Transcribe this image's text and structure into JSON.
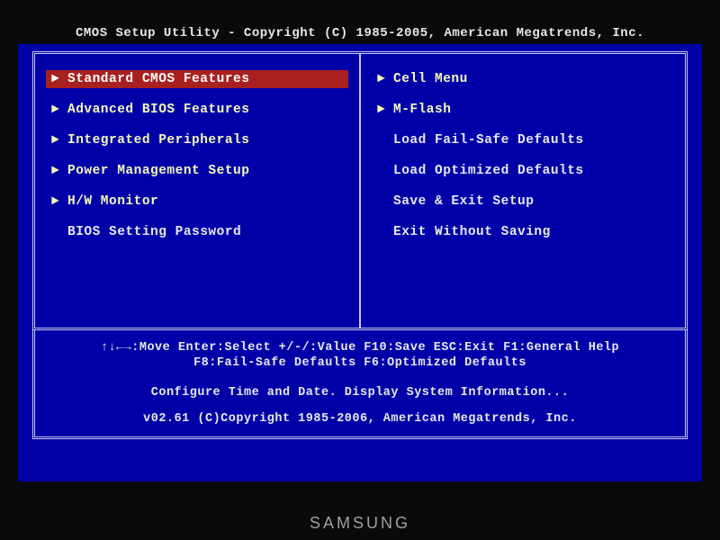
{
  "header": {
    "title": "CMOS Setup Utility - Copyright (C) 1985-2005, American Megatrends, Inc."
  },
  "menu": {
    "left": [
      {
        "label": "Standard CMOS Features",
        "arrow": true,
        "selected": true
      },
      {
        "label": "Advanced BIOS Features",
        "arrow": true,
        "selected": false
      },
      {
        "label": "Integrated Peripherals",
        "arrow": true,
        "selected": false
      },
      {
        "label": "Power Management Setup",
        "arrow": true,
        "selected": false
      },
      {
        "label": "H/W Monitor",
        "arrow": true,
        "selected": false
      },
      {
        "label": "BIOS Setting Password",
        "arrow": false,
        "selected": false
      }
    ],
    "right": [
      {
        "label": "Cell Menu",
        "arrow": true,
        "selected": false
      },
      {
        "label": "M-Flash",
        "arrow": true,
        "selected": false
      },
      {
        "label": "Load Fail-Safe Defaults",
        "arrow": false,
        "selected": false
      },
      {
        "label": "Load Optimized Defaults",
        "arrow": false,
        "selected": false
      },
      {
        "label": "Save & Exit Setup",
        "arrow": false,
        "selected": false
      },
      {
        "label": "Exit Without Saving",
        "arrow": false,
        "selected": false
      }
    ]
  },
  "help": {
    "line1": "↑↓←→:Move  Enter:Select  +/-/:Value  F10:Save  ESC:Exit  F1:General Help",
    "line2": "F8:Fail-Safe Defaults    F6:Optimized Defaults",
    "description": "Configure Time and Date.  Display System Information...",
    "copyright": "v02.61 (C)Copyright 1985-2006, American Megatrends, Inc."
  },
  "monitor": {
    "brand": "SAMSUNG"
  },
  "icons": {
    "arrow_right": "►"
  }
}
